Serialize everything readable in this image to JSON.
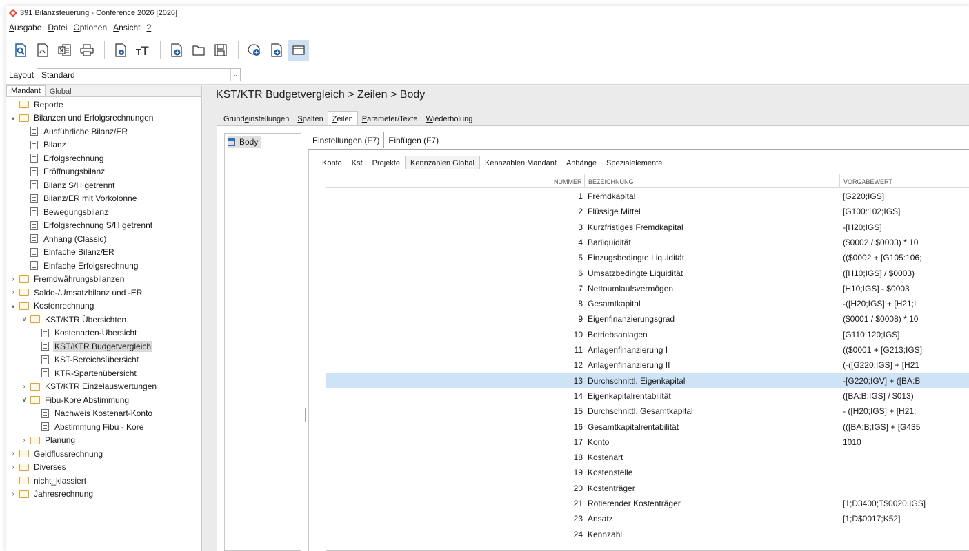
{
  "window": {
    "title": "391 Bilanzsteuerung - Conference 2026 [2026]"
  },
  "menu": [
    {
      "label": "Ausgabe",
      "u": "A",
      "rest": "usgabe"
    },
    {
      "label": "Datei",
      "u": "D",
      "rest": "atei"
    },
    {
      "label": "Optionen",
      "u": "O",
      "rest": "ptionen"
    },
    {
      "label": "Ansicht",
      "u": "A",
      "rest": "nsicht"
    },
    {
      "label": "?",
      "u": "?",
      "rest": ""
    }
  ],
  "toolbar": {
    "icons": [
      "preview-icon",
      "pdf-icon",
      "excel-icon",
      "print-icon",
      "settings-doc-icon",
      "font-size-icon",
      "new-doc-icon",
      "open-icon",
      "save-icon",
      "add-comment-icon",
      "add-settings-icon",
      "window-icon"
    ]
  },
  "layout": {
    "label": "Layout",
    "value": "Standard"
  },
  "left": {
    "tabs": [
      "Mandant",
      "Global"
    ],
    "tree": [
      {
        "label": "Reporte",
        "kind": "folder",
        "level": 0,
        "chev": ""
      },
      {
        "label": "Bilanzen und Erfolgsrechnungen",
        "kind": "folder",
        "level": 0,
        "chev": "v"
      },
      {
        "label": "Ausführliche Bilanz/ER",
        "kind": "doc",
        "level": 1,
        "chev": ""
      },
      {
        "label": "Bilanz",
        "kind": "doc",
        "level": 1,
        "chev": ""
      },
      {
        "label": "Erfolgsrechnung",
        "kind": "doc",
        "level": 1,
        "chev": ""
      },
      {
        "label": "Eröffnungsbilanz",
        "kind": "doc",
        "level": 1,
        "chev": ""
      },
      {
        "label": "Bilanz S/H getrennt",
        "kind": "doc",
        "level": 1,
        "chev": ""
      },
      {
        "label": "Bilanz/ER mit Vorkolonne",
        "kind": "doc",
        "level": 1,
        "chev": ""
      },
      {
        "label": "Bewegungsbilanz",
        "kind": "doc",
        "level": 1,
        "chev": ""
      },
      {
        "label": "Erfolgsrechnung S/H getrennt",
        "kind": "doc",
        "level": 1,
        "chev": ""
      },
      {
        "label": "Anhang (Classic)",
        "kind": "doc",
        "level": 1,
        "chev": ""
      },
      {
        "label": "Einfache Bilanz/ER",
        "kind": "doc",
        "level": 1,
        "chev": ""
      },
      {
        "label": "Einfache Erfolgsrechnung",
        "kind": "doc",
        "level": 1,
        "chev": ""
      },
      {
        "label": "Fremdwährungsbilanzen",
        "kind": "folder",
        "level": 0,
        "chev": ">"
      },
      {
        "label": "Saldo-/Umsatzbilanz und -ER",
        "kind": "folder",
        "level": 0,
        "chev": ">"
      },
      {
        "label": "Kostenrechnung",
        "kind": "folder",
        "level": 0,
        "chev": "v"
      },
      {
        "label": "KST/KTR Übersichten",
        "kind": "folder",
        "level": 1,
        "chev": "v"
      },
      {
        "label": "Kostenarten-Übersicht",
        "kind": "doc",
        "level": 2,
        "chev": ""
      },
      {
        "label": "KST/KTR Budgetvergleich",
        "kind": "doc",
        "level": 2,
        "chev": "",
        "selected": true
      },
      {
        "label": "KST-Bereichsübersicht",
        "kind": "doc",
        "level": 2,
        "chev": ""
      },
      {
        "label": "KTR-Spartenübersicht",
        "kind": "doc",
        "level": 2,
        "chev": ""
      },
      {
        "label": "KST/KTR Einzelauswertungen",
        "kind": "folder",
        "level": 1,
        "chev": ">"
      },
      {
        "label": "Fibu-Kore Abstimmung",
        "kind": "folder",
        "level": 1,
        "chev": "v"
      },
      {
        "label": "Nachweis Kostenart-Konto",
        "kind": "doc",
        "level": 2,
        "chev": ""
      },
      {
        "label": "Abstimmung Fibu - Kore",
        "kind": "doc",
        "level": 2,
        "chev": ""
      },
      {
        "label": "Planung",
        "kind": "folder",
        "level": 1,
        "chev": ">"
      },
      {
        "label": "Geldflussrechnung",
        "kind": "folder",
        "level": 0,
        "chev": ">"
      },
      {
        "label": "Diverses",
        "kind": "folder",
        "level": 0,
        "chev": ">"
      },
      {
        "label": "nicht_klassiert",
        "kind": "folder",
        "level": 0,
        "chev": ""
      },
      {
        "label": "Jahresrechnung",
        "kind": "folder",
        "level": 0,
        "chev": ">"
      }
    ]
  },
  "main": {
    "breadcrumb": "KST/KTR Budgetvergleich  >  Zeilen  >  Body",
    "tabs": [
      {
        "pre": "Grund",
        "u": "e",
        "post": "instellungen",
        "active": false
      },
      {
        "pre": "",
        "u": "S",
        "post": "palten",
        "active": false
      },
      {
        "pre": "",
        "u": "Z",
        "post": "eilen",
        "active": true
      },
      {
        "pre": "",
        "u": "P",
        "post": "arameter/Texte",
        "active": false
      },
      {
        "pre": "",
        "u": "W",
        "post": "iederholung",
        "active": false
      }
    ],
    "body_item": "Body",
    "subtabs": [
      {
        "label": "Einstellungen (F7)",
        "active": false
      },
      {
        "label": "Einfügen (F7)",
        "active": true
      }
    ],
    "subsubtabs": [
      {
        "label": "Konto",
        "active": false
      },
      {
        "label": "Kst",
        "active": false
      },
      {
        "label": "Projekte",
        "active": false
      },
      {
        "label": "Kennzahlen Global",
        "active": true
      },
      {
        "label": "Kennzahlen Mandant",
        "active": false
      },
      {
        "label": "Anhänge",
        "active": false
      },
      {
        "label": "Spezialelemente",
        "active": false
      }
    ],
    "grid": {
      "headers": {
        "num": "NUMMER",
        "bez": "BEZEICHNUNG",
        "vor": "VORGABEWERT"
      },
      "rows": [
        {
          "num": "1",
          "bez": "Fremdkapital",
          "vor": "[G220;IGS]"
        },
        {
          "num": "2",
          "bez": "Flüssige Mittel",
          "vor": "[G100:102;IGS]"
        },
        {
          "num": "3",
          "bez": "Kurzfristiges Fremdkapital",
          "vor": "-[H20;IGS]"
        },
        {
          "num": "4",
          "bez": "Barliquidität",
          "vor": "($0002 / $0003) * 10"
        },
        {
          "num": "5",
          "bez": "Einzugsbedingte Liquidität",
          "vor": "(($0002 + [G105:106;"
        },
        {
          "num": "6",
          "bez": "Umsatzbedingte Liquidität",
          "vor": "([H10;IGS] / $0003)"
        },
        {
          "num": "7",
          "bez": "Nettoumlaufsvermögen",
          "vor": "[H10;IGS] - $0003"
        },
        {
          "num": "8",
          "bez": "Gesamtkapital",
          "vor": "-([H20;IGS] + [H21;I"
        },
        {
          "num": "9",
          "bez": "Eigenfinanzierungsgrad",
          "vor": "($0001 / $0008) * 10"
        },
        {
          "num": "10",
          "bez": "Betriebsanlagen",
          "vor": "[G110:120;IGS]"
        },
        {
          "num": "11",
          "bez": "Anlagenfinanzierung I",
          "vor": "(($0001 + [G213;IGS]"
        },
        {
          "num": "12",
          "bez": "Anlagenfinanzierung II",
          "vor": "(-([G220;IGS] + [H21"
        },
        {
          "num": "13",
          "bez": "Durchschnittl. Eigenkapital",
          "vor": "-[G220;IGV] + ([BA:B",
          "selected": true
        },
        {
          "num": "14",
          "bez": "Eigenkapitalrentabilität",
          "vor": "([BA:B;IGS] / $013)"
        },
        {
          "num": "15",
          "bez": "Durchschnittl. Gesamtkapital",
          "vor": "- ([H20;IGS] + [H21;"
        },
        {
          "num": "16",
          "bez": "Gesamtkapitalrentabilität",
          "vor": "(([BA:B;IGS] + [G435"
        },
        {
          "num": "17",
          "bez": "Konto",
          "vor": "1010"
        },
        {
          "num": "18",
          "bez": "Kostenart",
          "vor": ""
        },
        {
          "num": "19",
          "bez": "Kostenstelle",
          "vor": ""
        },
        {
          "num": "20",
          "bez": "Kostenträger",
          "vor": ""
        },
        {
          "num": "21",
          "bez": "Rotierender Kostenträger",
          "vor": "[1;D3400;T$0020;IGS]"
        },
        {
          "num": "23",
          "bez": "Ansatz",
          "vor": "[1;D$0017;K52]"
        },
        {
          "num": "24",
          "bez": "Kennzahl",
          "vor": ""
        }
      ]
    }
  },
  "colors": {
    "selection": "#cfe3f6",
    "folder": "#d9a441",
    "accent": "#2f6fb7"
  }
}
